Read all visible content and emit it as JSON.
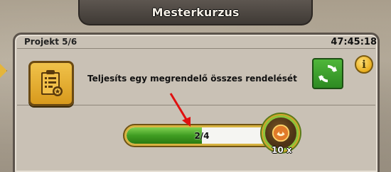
{
  "window": {
    "title": "Mesterkurzus"
  },
  "project": {
    "label": "Projekt 5/6",
    "timer": "47:45:18"
  },
  "task": {
    "description": "Teljesíts egy megrendelő összes rendelését",
    "icon": "order-document-icon"
  },
  "buttons": {
    "refresh_icon": "refresh-icon",
    "info_label": "i"
  },
  "progress": {
    "text": "2/4",
    "current": 2,
    "total": 4,
    "fraction": 0.5
  },
  "reward": {
    "icon": "coin-reward-icon",
    "count": "10 x"
  },
  "colors": {
    "progress_fill": "#3f9d22",
    "title_bar": "#4a443e",
    "accent_gold": "#e4b53c",
    "annotation_arrow": "#e01010"
  }
}
